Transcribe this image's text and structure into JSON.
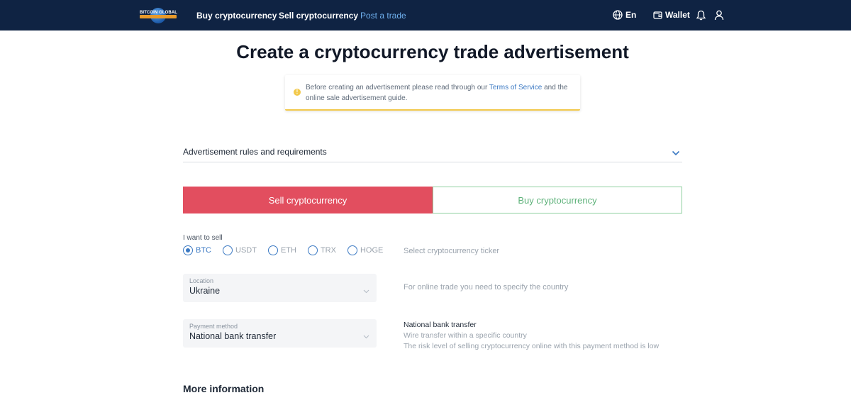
{
  "nav": {
    "logo_text": "BITCOIN GLOBAL",
    "links": [
      "Buy cryptocurrency",
      "Sell cryptocurrency",
      "Post a trade"
    ],
    "language": "En",
    "wallet": "Wallet"
  },
  "page_title": "Create a cryptocurrency trade advertisement",
  "notice": {
    "before": "Before creating an advertisement please read through our ",
    "link": "Terms of Service",
    "after": " and the online sale advertisement guide."
  },
  "rules": {
    "label": "Advertisement rules and requirements"
  },
  "toggle": {
    "sell": "Sell cryptocurrency",
    "buy": "Buy cryptocurrency"
  },
  "want_to_sell": {
    "label": "I want to sell",
    "options": [
      "BTC",
      "USDT",
      "ETH",
      "TRX",
      "HOGE"
    ],
    "selected": "BTC",
    "hint": "Select cryptocurrency ticker"
  },
  "location": {
    "label": "Location",
    "value": "Ukraine",
    "hint": "For online trade you need to specify the country"
  },
  "payment_method": {
    "label": "Payment method",
    "value": "National bank transfer",
    "desc_title": "National bank transfer",
    "desc_line1": "Wire transfer within a specific country",
    "desc_line2": "The risk level of selling cryptocurrency online with this payment method is low"
  },
  "more_info": "More information",
  "colors": {
    "navbar": "#0f2343",
    "sell": "#e24e5f",
    "buy": "#5eb27a",
    "accent": "#3b79c3",
    "warning": "#f2c94c"
  }
}
